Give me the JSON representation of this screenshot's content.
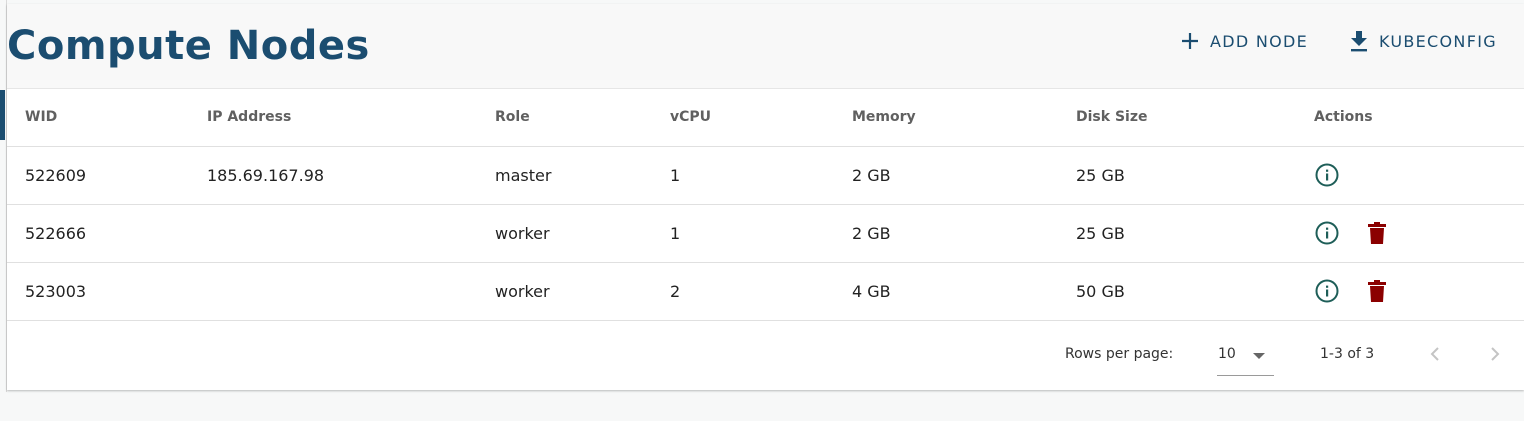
{
  "header": {
    "title": "Compute Nodes",
    "add_node_label": "ADD NODE",
    "kubeconfig_label": "KUBECONFIG"
  },
  "table": {
    "columns": [
      "WID",
      "IP Address",
      "Role",
      "vCPU",
      "Memory",
      "Disk Size",
      "Actions"
    ],
    "rows": [
      {
        "wid": "522609",
        "ip": "185.69.167.98",
        "role": "master",
        "vcpu": "1",
        "memory": "2 GB",
        "disk": "25 GB",
        "can_delete": false
      },
      {
        "wid": "522666",
        "ip": "",
        "role": "worker",
        "vcpu": "1",
        "memory": "2 GB",
        "disk": "25 GB",
        "can_delete": true
      },
      {
        "wid": "523003",
        "ip": "",
        "role": "worker",
        "vcpu": "2",
        "memory": "4 GB",
        "disk": "50 GB",
        "can_delete": true
      }
    ]
  },
  "pagination": {
    "rows_per_page_label": "Rows per page:",
    "rows_per_page_value": "10",
    "range_text": "1-3 of 3"
  },
  "icons": {
    "info": "info-circle-icon",
    "delete": "trash-icon",
    "add": "plus-icon",
    "download": "download-icon",
    "prev": "chevron-left-icon",
    "next": "chevron-right-icon"
  },
  "colors": {
    "primary": "#1b4d70",
    "info_icon": "#1e5e58",
    "delete_icon": "#8b0000"
  }
}
